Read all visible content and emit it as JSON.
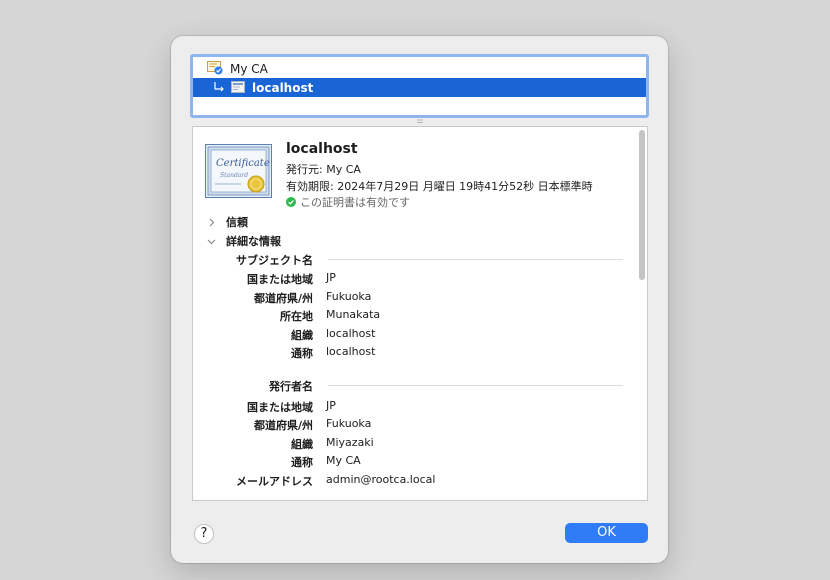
{
  "tree": {
    "items": [
      {
        "label": "My CA",
        "icon": "ca-certificate-icon"
      },
      {
        "label": "localhost",
        "icon": "certificate-icon",
        "selected": true
      }
    ]
  },
  "certificate": {
    "title": "localhost",
    "issuer": "発行元: My CA",
    "expiry": "有効期限: 2024年7月29日 月曜日 19時41分52秒 日本標準時",
    "status": "この証明書は有効です",
    "image_text_1": "Certificate",
    "image_text_2": "Standard"
  },
  "sections": {
    "trust_label": "信頼",
    "details_label": "詳細な情報"
  },
  "subject": {
    "header": "サブジェクト名",
    "fields": [
      {
        "label": "国または地域",
        "value": "JP"
      },
      {
        "label": "都道府県/州",
        "value": "Fukuoka"
      },
      {
        "label": "所在地",
        "value": "Munakata"
      },
      {
        "label": "組織",
        "value": "localhost"
      },
      {
        "label": "通称",
        "value": "localhost"
      }
    ]
  },
  "issuer_name": {
    "header": "発行者名",
    "fields": [
      {
        "label": "国または地域",
        "value": "JP"
      },
      {
        "label": "都道府県/州",
        "value": "Fukuoka"
      },
      {
        "label": "組織",
        "value": "Miyazaki"
      },
      {
        "label": "通称",
        "value": "My CA"
      },
      {
        "label": "メールアドレス",
        "value": "admin@rootca.local"
      }
    ]
  },
  "footer": {
    "help_label": "?",
    "ok_label": "OK"
  },
  "colors": {
    "accent": "#2f7cf6",
    "selection": "#1a65d6",
    "valid": "#2db84c"
  }
}
